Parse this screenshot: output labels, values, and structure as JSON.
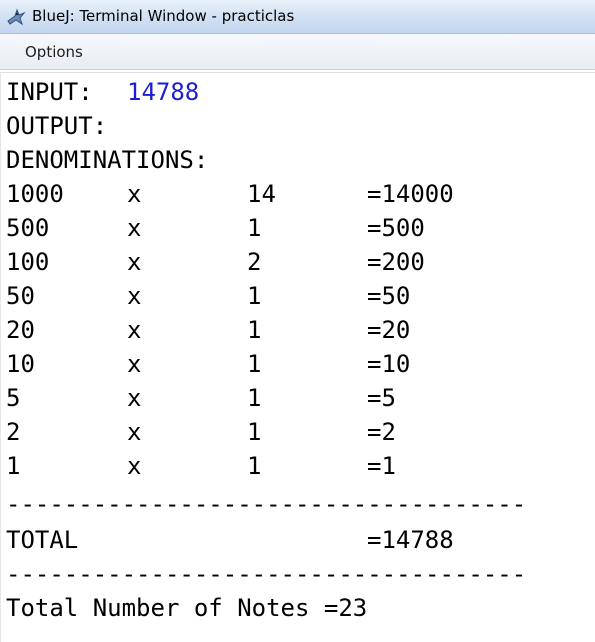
{
  "window": {
    "title": "BlueJ: Terminal Window - practiclas",
    "icon": "bluej-bird-icon"
  },
  "menubar": {
    "items": [
      "Options"
    ]
  },
  "terminal": {
    "input_label": "INPUT:",
    "input_value": "14788",
    "output_label": "OUTPUT:",
    "denominations_label": "DENOMINATIONS:",
    "rows": [
      {
        "denomination": "1000",
        "times": "x",
        "count": "14",
        "result": "=14000"
      },
      {
        "denomination": "500",
        "times": "x",
        "count": "1",
        "result": "=500"
      },
      {
        "denomination": "100",
        "times": "x",
        "count": "2",
        "result": "=200"
      },
      {
        "denomination": "50",
        "times": "x",
        "count": "1",
        "result": "=50"
      },
      {
        "denomination": "20",
        "times": "x",
        "count": "1",
        "result": "=20"
      },
      {
        "denomination": "10",
        "times": "x",
        "count": "1",
        "result": "=10"
      },
      {
        "denomination": "5",
        "times": "x",
        "count": "1",
        "result": "=5"
      },
      {
        "denomination": "2",
        "times": "x",
        "count": "1",
        "result": "=2"
      },
      {
        "denomination": "1",
        "times": "x",
        "count": "1",
        "result": "=1"
      }
    ],
    "separator": "------------------------------------",
    "total_label": "TOTAL",
    "total_value": "=14788",
    "notes_line": "Total Number of Notes =23"
  },
  "colors": {
    "input_value": "#1c1cd8",
    "text": "#000000",
    "background": "#ffffff"
  }
}
